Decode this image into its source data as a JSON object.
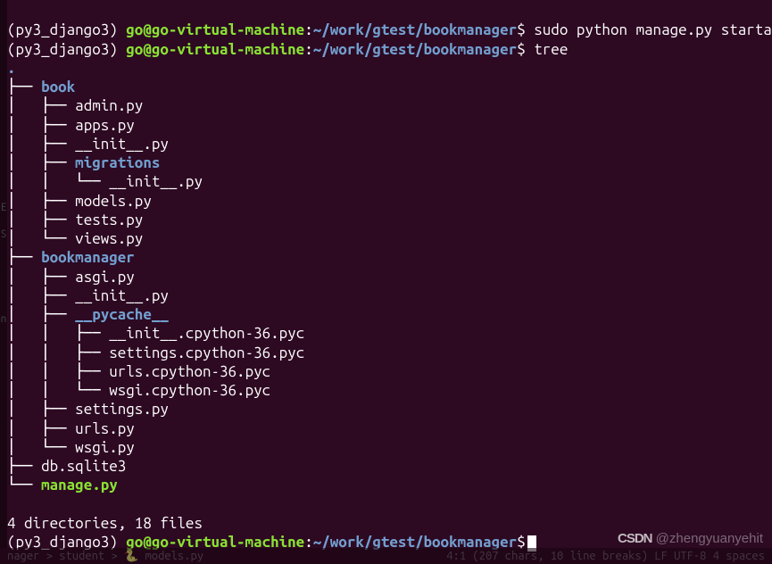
{
  "prompt1": {
    "env": "(py3_django3) ",
    "userhost": "go@go-virtual-machine",
    "colon": ":",
    "path": "~/work/gtest/bookmanager",
    "dollar": "$ ",
    "cmd": "sudo python manage.py startapp book"
  },
  "prompt2": {
    "env": "(py3_django3) ",
    "userhost": "go@go-virtual-machine",
    "colon": ":",
    "path": "~/work/gtest/bookmanager",
    "dollar": "$ ",
    "cmd": "tree"
  },
  "tree": {
    "root": ".",
    "l1": "├── ",
    "l1_book": "book",
    "l2a": "│   ├── ",
    "l2e": "│   └── ",
    "admin": "admin.py",
    "apps": "apps.py",
    "init": "__init__.py",
    "migrations": "migrations",
    "l3e": "│   │   └── ",
    "mig_init": "__init__.py",
    "models": "models.py",
    "tests": "tests.py",
    "views": "views.py",
    "bookmanager": "bookmanager",
    "asgi": "asgi.py",
    "bm_init": "__init__.py",
    "pycache": "__pycache__",
    "l3pa": "│   │   ├── ",
    "l3pe": "│   │   └── ",
    "pc_init": "__init__.cpython-36.pyc",
    "pc_settings": "settings.cpython-36.pyc",
    "pc_urls": "urls.cpython-36.pyc",
    "pc_wsgi": "wsgi.cpython-36.pyc",
    "settings": "settings.py",
    "urls": "urls.py",
    "wsgi": "wsgi.py",
    "db": "db.sqlite3",
    "le": "└── ",
    "manage": "manage.py"
  },
  "summary": "4 directories, 18 files",
  "prompt3": {
    "env": "(py3_django3) ",
    "userhost": "go@go-virtual-machine",
    "colon": ":",
    "path": "~/work/gtest/bookmanager",
    "dollar": "$"
  },
  "watermark": {
    "brand": "CSDN",
    "handle": " @zhengyuanyehit"
  },
  "status": {
    "left": "nager > student > 🐍 models.py",
    "right": "4:1 (207 chars, 10 line breaks)  LF  UTF-8  4 spaces"
  },
  "gutter": {
    "g1": "E",
    "g2": "S",
    "g3": "n"
  }
}
